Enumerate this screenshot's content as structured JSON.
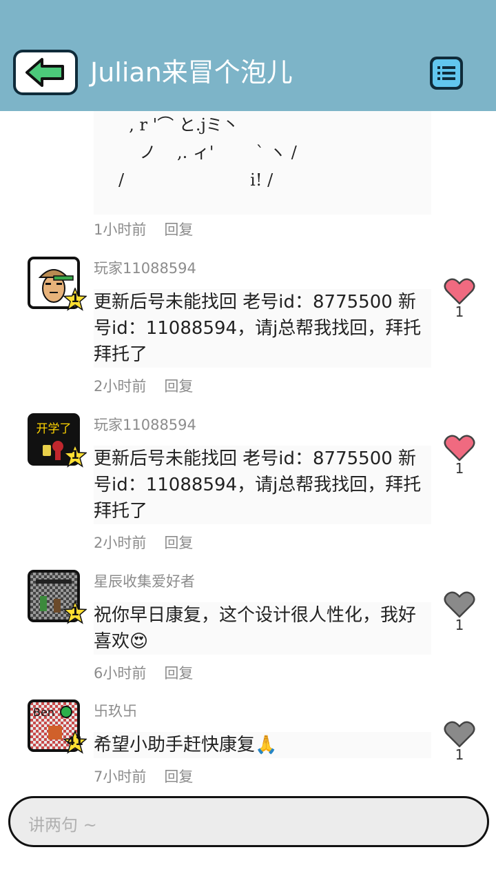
{
  "header": {
    "title": "Julian来冒个泡儿",
    "back_icon": "arrow-left-icon",
    "menu_icon": "list-menu-icon",
    "bg_color": "#7db4c8"
  },
  "prev_post": {
    "ascii_lines": [
      "  , r '⌒ と.jミ丶",
      "    ノ    ,. ィ'        ` ヽ /",
      "/                        i! /"
    ],
    "time": "1小时前",
    "reply": "回复"
  },
  "comments": [
    {
      "username": "玩家11088594",
      "level": "1",
      "text": "更新后号未能找回 老号id：8775500 新号id：11088594，请j总帮我找回，拜托拜托了",
      "time": "2小时前",
      "reply": "回复",
      "likes": "1",
      "liked": true
    },
    {
      "username": "玩家11088594",
      "level": "1",
      "avatar_text": "开学了",
      "text": "更新后号未能找回 老号id：8775500 新号id：11088594，请j总帮我找回，拜托拜托了",
      "time": "2小时前",
      "reply": "回复",
      "likes": "1",
      "liked": true
    },
    {
      "username": "星辰收集爱好者",
      "level": "1",
      "text": "祝你早日康复，这个设计很人性化，我好喜欢😍",
      "time": "6小时前",
      "reply": "回复",
      "likes": "1",
      "liked": false
    },
    {
      "username": "卐玖卐",
      "level": "41",
      "avatar_text": "Ben",
      "text": "希望小助手赶快康复🙏",
      "time": "7小时前",
      "reply": "回复",
      "likes": "1",
      "liked": false
    }
  ],
  "input": {
    "placeholder": "讲两句 ~"
  },
  "colors": {
    "liked_heart": "#f06a80",
    "unliked_heart": "#8a8a8a",
    "level_star": "#ffe033"
  }
}
